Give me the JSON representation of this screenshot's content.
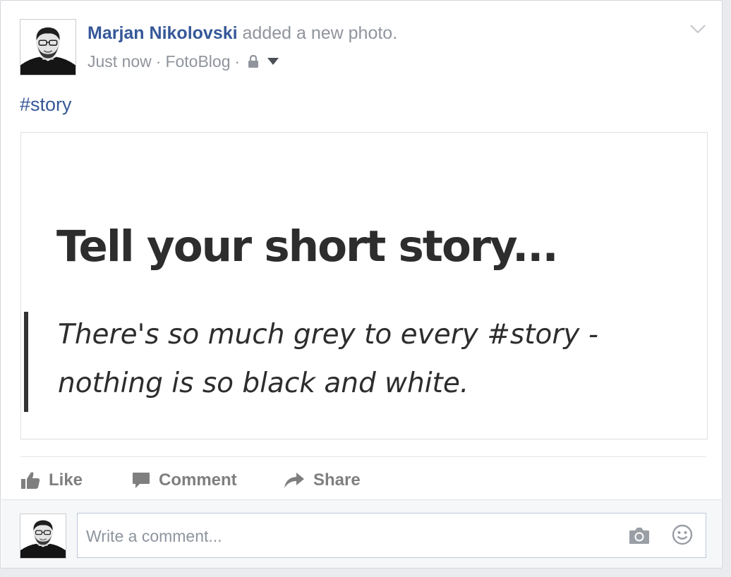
{
  "post": {
    "author": "Marjan Nikolovski",
    "action": "added a new photo.",
    "time": "Just now",
    "app": "FotoBlog",
    "separator": "·",
    "privacy_icon": "lock-icon",
    "audience_icon": "caret-down-icon",
    "options_icon": "chevron-down-icon",
    "hashtag": "#story"
  },
  "photo": {
    "title": "Tell your short story...",
    "quote": "There's so much grey to every #story - nothing is so black and white."
  },
  "actions": {
    "like": "Like",
    "comment": "Comment",
    "share": "Share"
  },
  "comment_box": {
    "placeholder": "Write a comment...",
    "camera_icon": "camera-icon",
    "emoji_icon": "smiley-icon"
  },
  "colors": {
    "link": "#365899",
    "meta": "#90949c",
    "action": "#7f7f7f"
  }
}
